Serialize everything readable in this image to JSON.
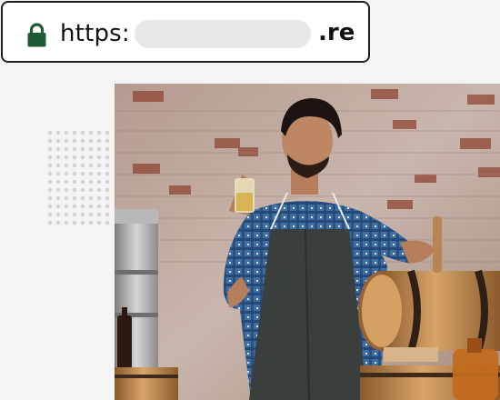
{
  "address_bar": {
    "scheme": "https:",
    "tld": ".re",
    "lock_icon": "lock-icon",
    "lock_color": "#1e5b35"
  },
  "photo": {
    "subject": "man-tasting-beer-photo",
    "accent_apron": "#3a3f3d",
    "accent_shirt": "#3f6ea3"
  }
}
